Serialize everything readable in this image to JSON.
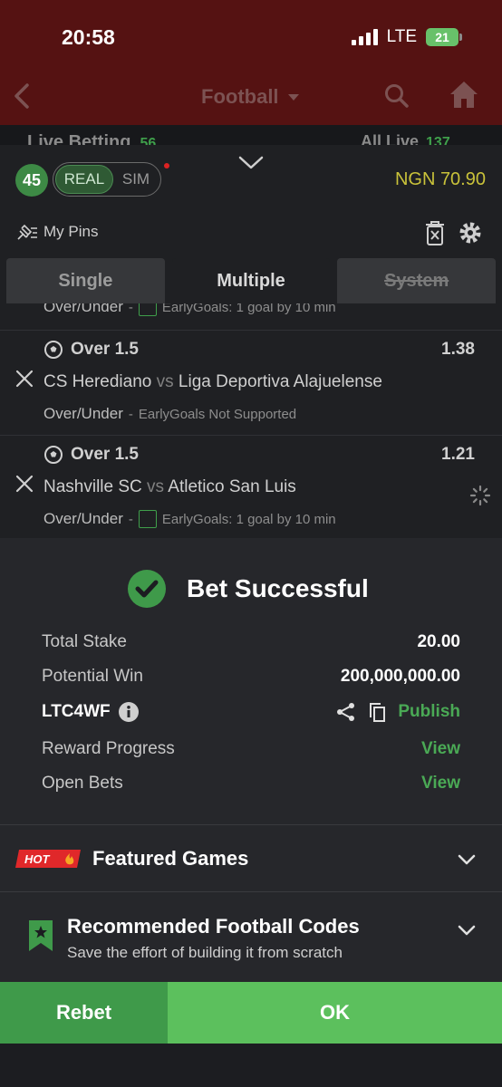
{
  "status_bar": {
    "time": "20:58",
    "network": "LTE",
    "battery": "21"
  },
  "nav": {
    "title": "Football"
  },
  "live_strip": {
    "left_label": "Live Betting",
    "left_count": "56",
    "right_label": "All Live",
    "right_count": "137"
  },
  "slip": {
    "bet_count": "45",
    "mode_real": "REAL",
    "mode_sim": "SIM",
    "balance": "NGN 70.90",
    "my_pins": "My Pins",
    "tabs": [
      {
        "label": "Single"
      },
      {
        "label": "Multiple"
      },
      {
        "label": "System"
      }
    ],
    "partial_row": {
      "market_type": "Over/Under",
      "sub": "EarlyGoals: 1 goal by 10 min"
    },
    "selections": [
      {
        "market": "Over 1.5",
        "odds": "1.38",
        "home": "CS Herediano",
        "vs": "vs",
        "away": "Liga Deportiva Alajuelense",
        "market_type": "Over/Under",
        "sub": "EarlyGoals Not Supported"
      },
      {
        "market": "Over 1.5",
        "odds": "1.21",
        "home": "Nashville SC",
        "vs": "vs",
        "away": "Atletico San Luis",
        "market_type": "Over/Under",
        "sub": "EarlyGoals: 1 goal by 10 min"
      }
    ]
  },
  "sheet": {
    "title": "Bet Successful",
    "total_stake_label": "Total Stake",
    "total_stake_value": "20.00",
    "potential_win_label": "Potential Win",
    "potential_win_value": "200,000,000.00",
    "booking_code": "LTC4WF",
    "publish_label": "Publish",
    "reward_label": "Reward Progress",
    "reward_link": "View",
    "open_bets_label": "Open Bets",
    "open_bets_link": "View",
    "featured_badge": "HOT",
    "featured_label": "Featured Games",
    "recommend_title": "Recommended Football Codes",
    "recommend_sub": "Save the effort of building it from scratch"
  },
  "footer": {
    "rebet": "Rebet",
    "ok": "OK"
  },
  "colors": {
    "brand_green": "#5cc05d",
    "dark_green": "#3f9a4a",
    "balance_yellow": "#c9c23a",
    "header_red": "#551212"
  },
  "icons": [
    "back-arrow-icon",
    "caret-down-icon",
    "search-icon",
    "home-icon",
    "chevron-down-icon",
    "pin-icon",
    "trash-icon",
    "gear-icon",
    "close-icon",
    "soccer-ball-icon",
    "spinner-icon",
    "check-circle-icon",
    "info-icon",
    "share-icon",
    "copy-icon",
    "hot-badge-icon",
    "bookmark-star-icon"
  ]
}
